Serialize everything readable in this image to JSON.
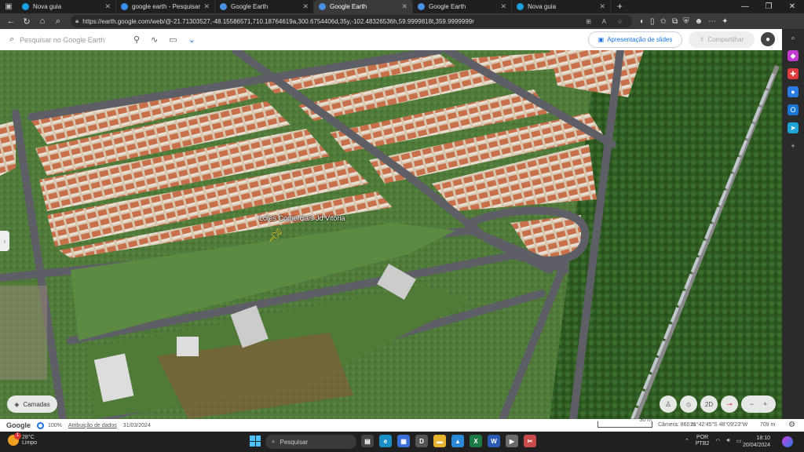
{
  "browser": {
    "tabs": [
      {
        "label": "Nova guia",
        "favicon_color": "#1aa0e0",
        "active": false
      },
      {
        "label": "google earth - Pesquisar",
        "favicon_color": "#3b8ded",
        "active": false
      },
      {
        "label": "Google Earth",
        "favicon_color": "#4a90e2",
        "active": false
      },
      {
        "label": "Google Earth",
        "favicon_color": "#4a90e2",
        "active": true
      },
      {
        "label": "Google Earth",
        "favicon_color": "#4a90e2",
        "active": false
      },
      {
        "label": "Nova guia",
        "favicon_color": "#1aa0e0",
        "active": false
      }
    ],
    "new_tab_symbol": "+",
    "url": "https://earth.google.com/web/@-21.71303527,-48.15586571,710.18764619a,300.6754406d,35y,-102.48326536h,59.9999818t,359.9999999r"
  },
  "earth": {
    "search_placeholder": "Pesquisar no Google Earth",
    "slides_button": "Apresentação de slides",
    "share_button": "Compartilhar",
    "placemark_label": "Lotes Comerciais Jd Vitória",
    "layers_button": "Camadas",
    "view_toggle": "2D",
    "zoom_out": "−",
    "zoom_in": "+"
  },
  "status": {
    "logo": "Google",
    "imagery_percent": "100%",
    "data_attribution": "Atribuição de dados",
    "imagery_date": "31/03/2024",
    "scale": "30 m",
    "camera": "Câmera: 860 m",
    "coordinates": "21°42'45\"S 48°09'23\"W",
    "altitude": "709 m"
  },
  "taskbar": {
    "weather_temp": "28°C",
    "weather_desc": "Limpo",
    "weather_badge": "1",
    "search_label": "Pesquisar",
    "lang_line1": "POR",
    "lang_line2": "PTB2",
    "time": "18:10",
    "date": "20/04/2024"
  }
}
